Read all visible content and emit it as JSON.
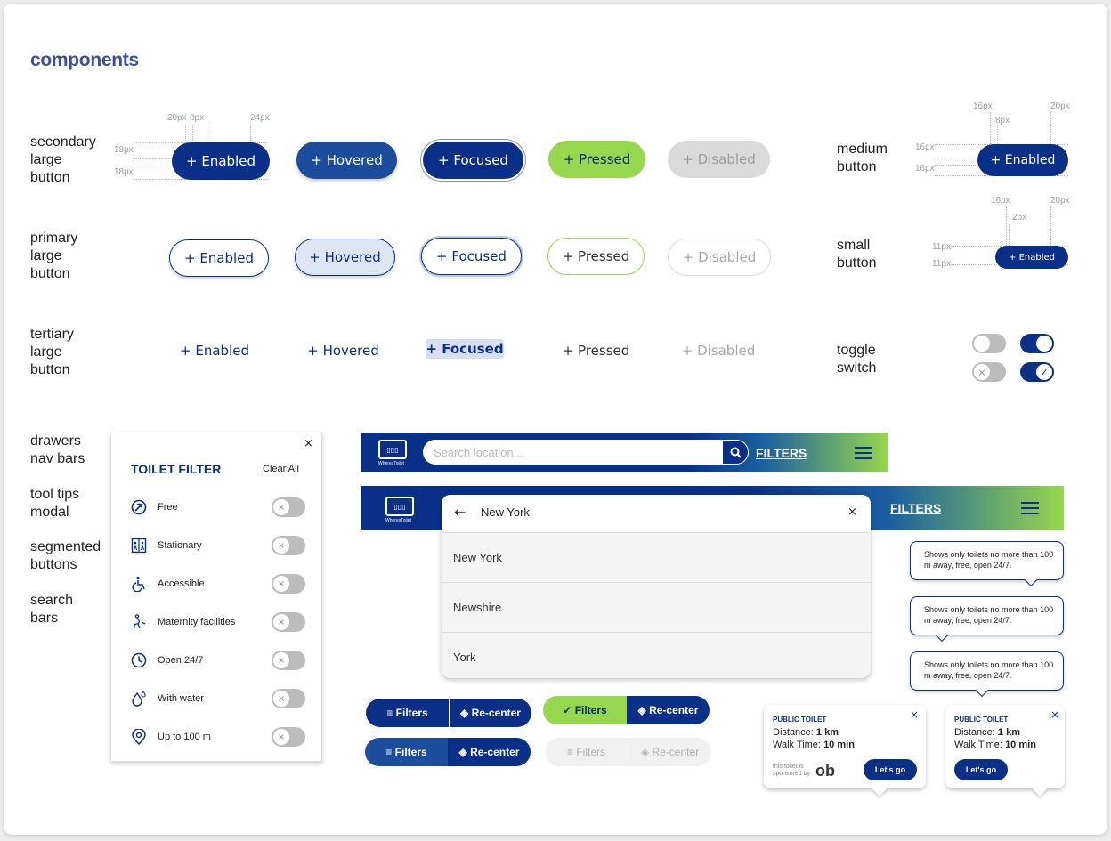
{
  "page": {
    "title": "components"
  },
  "labels": {
    "secondary": [
      "secondary",
      "large",
      "button"
    ],
    "primary": [
      "primary",
      "large",
      "button"
    ],
    "tertiary": [
      "tertiary",
      "large",
      "button"
    ],
    "medium": [
      "medium",
      "button"
    ],
    "small": [
      "small",
      "button"
    ],
    "toggle": [
      "toggle",
      "switch"
    ],
    "misc": [
      "drawers",
      "nav bars",
      "tool tips",
      "modal",
      "segmented",
      "buttons",
      "search",
      "bars"
    ]
  },
  "buttons": {
    "enabled": "+ Enabled",
    "hovered": "+ Hovered",
    "focused": "+ Focused",
    "pressed": "+ Pressed",
    "disabled": "+ Disabled"
  },
  "dimensions": {
    "d20": "20px",
    "d8": "8px",
    "d24": "24px",
    "d18a": "18px",
    "d18b": "18px",
    "m16a": "16px",
    "m8": "8px",
    "m20": "20px",
    "m16b": "16px",
    "m16c": "16px",
    "s16": "16px",
    "s2": "2px",
    "s20": "20px",
    "s11a": "11px",
    "s11b": "11px"
  },
  "toggles": {
    "off_icon": "×",
    "on_icon": "✓"
  },
  "drawer": {
    "title": "TOILET FILTER",
    "clear": "Clear All",
    "close": "×",
    "items": [
      {
        "label": "Free",
        "icon": "free-icon"
      },
      {
        "label": "Stationary",
        "icon": "stationary-icon"
      },
      {
        "label": "Accessible",
        "icon": "wheelchair-icon"
      },
      {
        "label": "Maternity facilities",
        "icon": "maternity-icon"
      },
      {
        "label": "Open 24/7",
        "icon": "clock-icon"
      },
      {
        "label": "With water",
        "icon": "water-icon"
      },
      {
        "label": "Up to 100 m",
        "icon": "location-pin-icon"
      }
    ]
  },
  "navbar": {
    "logo_text": "WheresToilet",
    "search_placeholder": "Search location...",
    "filters": "FILTERS"
  },
  "search_panel": {
    "query": "New York",
    "close": "×",
    "results": [
      "New York",
      "Newshire",
      "York"
    ]
  },
  "tooltip": {
    "text": "Shows only toilets no more than 100 m away, free, open 24/7."
  },
  "segmented": {
    "filters": "Filters",
    "recenter": "Re-center"
  },
  "modal": {
    "title": "PUBLIC TOILET",
    "distance_label": "Distance:",
    "distance_value": "1 km",
    "walk_label": "Walk Time:",
    "walk_value": "10 min",
    "cta": "Let's go",
    "sponsor_line1": "this toilet is",
    "sponsor_line2": "sponsored by",
    "sponsor_logo": "ob",
    "close": "×"
  },
  "colors": {
    "primary": "#0a2f86",
    "accent": "#97d74d",
    "disabled": "#dadada"
  }
}
